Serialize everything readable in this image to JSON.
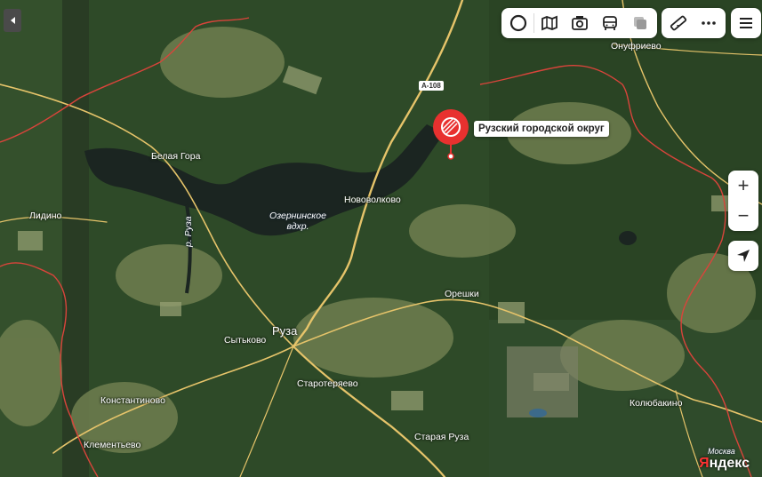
{
  "map": {
    "places": [
      {
        "name": "Онуфриево",
        "kind": "village"
      },
      {
        "name": "Белая Гора",
        "kind": "village"
      },
      {
        "name": "Лидино",
        "kind": "village"
      },
      {
        "name": "Нововолково",
        "kind": "village"
      },
      {
        "name": "Орешки",
        "kind": "village"
      },
      {
        "name": "Руза",
        "kind": "town"
      },
      {
        "name": "Сытьково",
        "kind": "village"
      },
      {
        "name": "Старотеряево",
        "kind": "village"
      },
      {
        "name": "Константиново",
        "kind": "village"
      },
      {
        "name": "Клементьево",
        "kind": "village"
      },
      {
        "name": "Старая Руза",
        "kind": "village"
      },
      {
        "name": "Колюбакино",
        "kind": "village"
      }
    ],
    "water_labels": {
      "reservoir": "Озернинское вдхр.",
      "river_ruza": "р. Руза",
      "river_moskva": "Москва"
    },
    "road_shield": "А-108",
    "selected_object": {
      "label": "Рузский городской округ",
      "marker_color": "#e8312f"
    },
    "boundary_color": "#d9443b",
    "road_color": "#e6c46a"
  },
  "toolbar": {
    "layers": [
      "layers-icon",
      "map-type-icon",
      "panorama-icon",
      "transit-icon",
      "traffic-icon"
    ],
    "tools": [
      "ruler-icon",
      "more-icon"
    ],
    "menu": "menu-icon"
  },
  "controls": {
    "zoom_in": "+",
    "zoom_out": "−"
  },
  "logo": {
    "ya": "Я",
    "ndex": "ндекс"
  }
}
